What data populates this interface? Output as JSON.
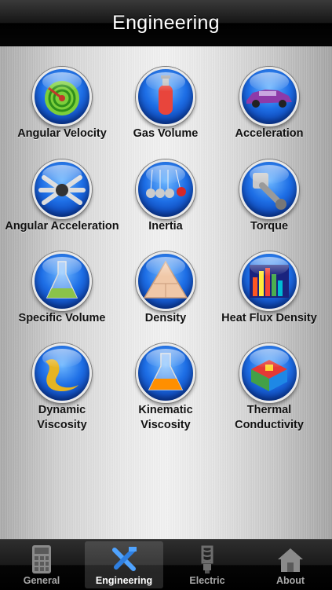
{
  "header": {
    "title": "Engineering"
  },
  "grid": {
    "items": [
      {
        "label_line1": "Angular Velocity",
        "label_line2": "",
        "icon": "spiral-disc-icon"
      },
      {
        "label_line1": "Gas Volume",
        "label_line2": "",
        "icon": "gas-cylinder-icon"
      },
      {
        "label_line1": "Acceleration",
        "label_line2": "",
        "icon": "car-icon"
      },
      {
        "label_line1": "Angular Acceleration",
        "label_line2": "",
        "icon": "spinning-blades-icon"
      },
      {
        "label_line1": "Inertia",
        "label_line2": "",
        "icon": "newtons-cradle-icon"
      },
      {
        "label_line1": "Torque",
        "label_line2": "",
        "icon": "piston-icon"
      },
      {
        "label_line1": "Specific Volume",
        "label_line2": "",
        "icon": "flask-icon"
      },
      {
        "label_line1": "Density",
        "label_line2": "",
        "icon": "triangle-formula-icon"
      },
      {
        "label_line1": "Heat Flux Density",
        "label_line2": "",
        "icon": "heat-map-icon"
      },
      {
        "label_line1": "Dynamic",
        "label_line2": "Viscosity",
        "icon": "liquid-splash-icon"
      },
      {
        "label_line1": "Kinematic",
        "label_line2": "Viscosity",
        "icon": "beaker-icon"
      },
      {
        "label_line1": "Thermal",
        "label_line2": "Conductivity",
        "icon": "thermal-block-icon"
      }
    ]
  },
  "tabs": [
    {
      "label": "General",
      "icon": "calculator-icon",
      "selected": false
    },
    {
      "label": "Engineering",
      "icon": "tools-icon",
      "selected": true
    },
    {
      "label": "Electric",
      "icon": "light-bulb-icon",
      "selected": false
    },
    {
      "label": "About",
      "icon": "house-icon",
      "selected": false
    }
  ],
  "colors": {
    "icon_blue": "#1e6fe6",
    "tab_active": "#ffffff",
    "tab_inactive": "#a9a9a9"
  }
}
